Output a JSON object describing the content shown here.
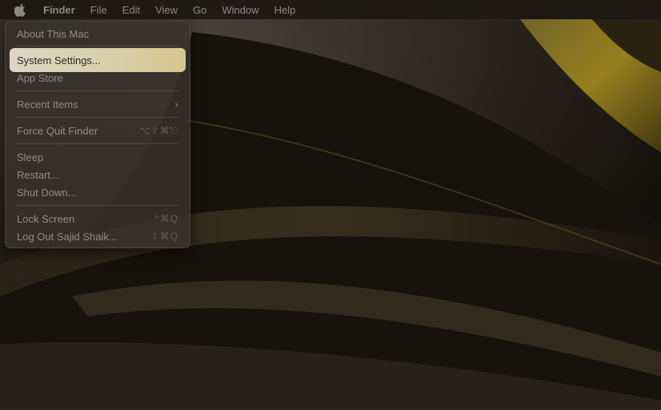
{
  "menubar": {
    "apple_icon": "apple-logo-icon",
    "items": [
      "Finder",
      "File",
      "Edit",
      "View",
      "Go",
      "Window",
      "Help"
    ]
  },
  "apple_menu": {
    "about": "About This Mac",
    "system_settings": "System Settings...",
    "app_store": "App Store",
    "recent_items": "Recent Items",
    "recent_items_icon": "chevron-right-icon",
    "force_quit": "Force Quit Finder",
    "force_quit_shortcut": "⌥⇧⌘⎋",
    "sleep": "Sleep",
    "restart": "Restart...",
    "shut_down": "Shut Down...",
    "lock_screen": "Lock Screen",
    "lock_screen_shortcut": "^⌘Q",
    "log_out": "Log Out Sajid Shaik...",
    "log_out_shortcut": "⇧⌘Q"
  },
  "colors": {
    "highlight": "#dcd4b4",
    "wallpaper_gold": "#6b5a18",
    "menu_bg": "#37322c"
  }
}
